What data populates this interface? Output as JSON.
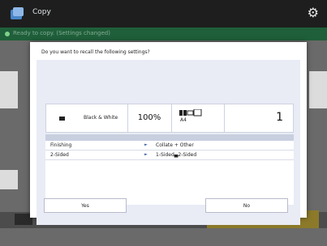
{
  "app": {
    "title": "Copy",
    "status_text": "Ready to copy. (Settings changed)"
  },
  "dialog": {
    "message": "Do you want to recall the following settings?",
    "color_mode": "Black & White",
    "zoom": "100%",
    "paper_size": "A4",
    "copies": "1",
    "settings": [
      {
        "name": "Finishing",
        "value": "Collate + Other"
      },
      {
        "name": "2-Sided",
        "value": "1-Sided▄2-Sided"
      }
    ],
    "yes_label": "Yes",
    "no_label": "No"
  }
}
